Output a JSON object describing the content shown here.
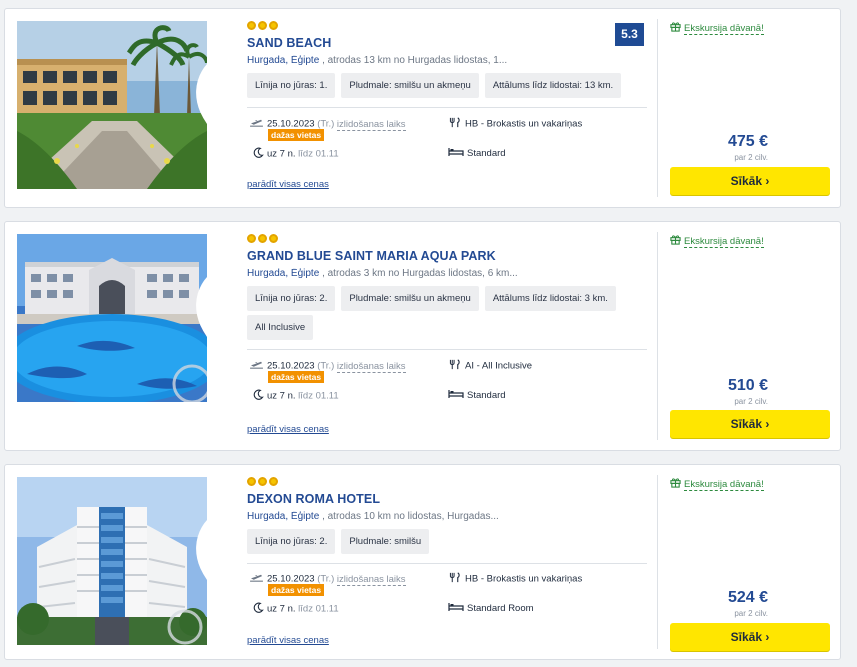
{
  "hotels": [
    {
      "stars": 3,
      "name": "SAND BEACH",
      "location": "Hurgada, Ēģipte",
      "location_detail": ", atrodas 13 km no Hurgadas lidostas, 1...",
      "rating": "5.3",
      "tags": [
        "Līnija no jūras: 1.",
        "Pludmale: smilšu un akmeņu",
        "Attālums līdz lidostai: 13 km."
      ],
      "date": "25.10.2023",
      "weekday": "(Tr.)",
      "departure_label": "izlidošanas laiks",
      "badge": "dažas vietas",
      "nights": "uz 7 n.",
      "until": "līdz 01.11",
      "board": "HB - Brokastis un vakariņas",
      "room": "Standard",
      "all_prices": "parādīt visas cenas",
      "gift": "Ekskursija dāvanā!",
      "price": "475 €",
      "per_person": "par 2 cilv.",
      "button": "Sīkāk ›"
    },
    {
      "stars": 3,
      "name": "GRAND BLUE SAINT MARIA AQUA PARK",
      "location": "Hurgada, Ēģipte",
      "location_detail": ", atrodas 3 km no Hurgadas lidostas, 6 km...",
      "rating": "",
      "tags": [
        "Līnija no jūras: 2.",
        "Pludmale: smilšu un akmeņu",
        "Attālums līdz lidostai: 3 km.",
        "All Inclusive"
      ],
      "date": "25.10.2023",
      "weekday": "(Tr.)",
      "departure_label": "izlidošanas laiks",
      "badge": "dažas vietas",
      "nights": "uz 7 n.",
      "until": "līdz 01.11",
      "board": "AI - All Inclusive",
      "room": "Standard",
      "all_prices": "parādīt visas cenas",
      "gift": "Ekskursija dāvanā!",
      "price": "510 €",
      "per_person": "par 2 cilv.",
      "button": "Sīkāk ›"
    },
    {
      "stars": 3,
      "name": "DEXON ROMA HOTEL",
      "location": "Hurgada, Ēģipte",
      "location_detail": ", atrodas 10 km no lidostas, Hurgadas...",
      "rating": "",
      "tags": [
        "Līnija no jūras: 2.",
        "Pludmale: smilšu"
      ],
      "date": "25.10.2023",
      "weekday": "(Tr.)",
      "departure_label": "izlidošanas laiks",
      "badge": "dažas vietas",
      "nights": "uz 7 n.",
      "until": "līdz 01.11",
      "board": "HB - Brokastis un vakariņas",
      "room": "Standard Room",
      "all_prices": "parādīt visas cenas",
      "gift": "Ekskursija dāvanā!",
      "price": "524 €",
      "per_person": "par 2 cilv.",
      "button": "Sīkāk ›"
    }
  ],
  "icons": {
    "heart": "heart-outline-icon",
    "gift": "gift-icon",
    "plane": "plane-departure-icon",
    "moon": "moon-icon",
    "board": "fork-knife-icon",
    "bed": "bed-icon"
  },
  "colors": {
    "brand_blue": "#234a93",
    "cta_yellow": "#ffe600",
    "gift_green": "#2d8a3e",
    "badge_orange": "#f29100",
    "star_gold": "#f6c400"
  }
}
